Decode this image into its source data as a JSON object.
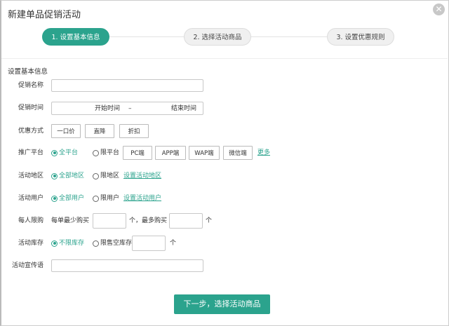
{
  "dialog": {
    "title": "新建单品促销活动",
    "close_icon": "close-circle-icon"
  },
  "steps": [
    {
      "label": "1. 设置基本信息",
      "active": true
    },
    {
      "label": "2. 选择活动商品",
      "active": false
    },
    {
      "label": "3. 设置优惠规则",
      "active": false
    }
  ],
  "section_title": "设置基本信息",
  "form": {
    "name": {
      "label": "促销名称",
      "value": ""
    },
    "time": {
      "label": "促销时间",
      "start_placeholder": "开始时间",
      "separator": "–",
      "end_placeholder": "结束时间"
    },
    "discount": {
      "label": "优惠方式",
      "options": [
        "一口价",
        "直降",
        "折扣"
      ]
    },
    "platform": {
      "label": "推广平台",
      "all": "全平台",
      "limited": "限平台",
      "options": [
        "PC端",
        "APP端",
        "WAP端",
        "微信端"
      ],
      "more": "更多"
    },
    "region": {
      "label": "活动地区",
      "all": "全部地区",
      "limited": "限地区",
      "link": "设置活动地区"
    },
    "users": {
      "label": "活动用户",
      "all": "全部用户",
      "limited": "限用户",
      "link": "设置活动用户"
    },
    "limit": {
      "label": "每人限购",
      "min_prefix": "每单最少购买",
      "min_suffix": "个，最多购买",
      "max_suffix": "个",
      "min_value": "",
      "max_value": ""
    },
    "stock": {
      "label": "活动库存",
      "unlimited": "不限库存",
      "limited": "限售空库存",
      "unit": "个",
      "value": ""
    },
    "slogan": {
      "label": "活动宣传语",
      "value": ""
    }
  },
  "next_button": "下一步，选择活动商品",
  "colors": {
    "accent": "#2ba38d"
  }
}
